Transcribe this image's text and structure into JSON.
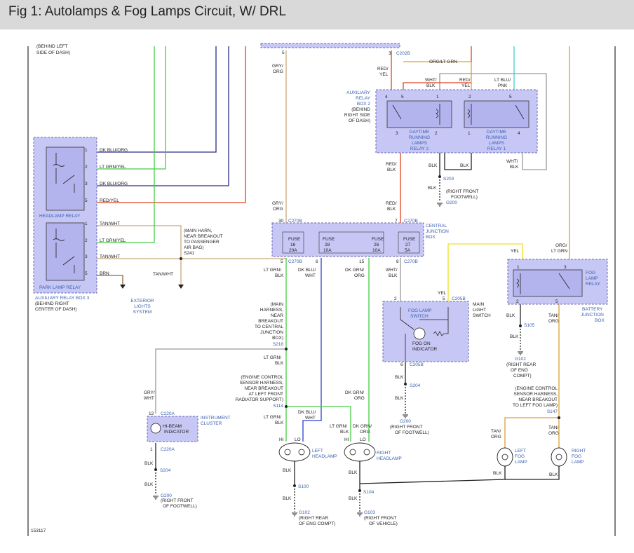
{
  "title": "Fig 1: Autolamps & Fog Lamps Circuit, W/ DRL",
  "colors": {
    "title_bg": "#d9d9d9",
    "component_fill": "#c7c7f5",
    "label_blue": "#3a5fb0",
    "wire_green": "#44cc44",
    "wire_navy": "#2a2a8a",
    "wire_blue": "#2a3fd0",
    "wire_red": "#e04020",
    "wire_tan": "#c8a878",
    "wire_gray": "#999999",
    "wire_orange": "#d9a030",
    "wire_yellow": "#f0e020",
    "wire_cyan": "#40d0d0",
    "wire_black": "#222222",
    "wire_brown": "#8a6a30"
  },
  "figure_number": "153117",
  "labels": {
    "behind_left_dash": "SIDE OF DASH)",
    "behind_left_dash_top": "(BEHIND LEFT",
    "c202b": "C202B",
    "pin5_top": "5",
    "pin3_top": "3",
    "gry_org_top1": "GRY/",
    "gry_org_top2": "ORG",
    "org_lt_grn_top": "ORG/LT GRN",
    "red_yel1": "RED/",
    "red_yel2": "YEL",
    "wht_blk1": "WHT/",
    "wht_blk2": "BLK",
    "red_yel_b1": "RED/",
    "red_yel_b2": "YEL",
    "lt_blu_pnk1": "LT BLU/",
    "lt_blu_pnk2": "PNK",
    "aux_relay_box2": [
      "AUXILIARY",
      "RELAY",
      "BOX 2",
      "(BEHIND",
      "RIGHT SIDE",
      "OF DASH)"
    ],
    "drl_relay2": [
      "DAYTIME",
      "RUNNING",
      "LAMPS",
      "RELAY 2"
    ],
    "drl_relay1": [
      "DAYTIME",
      "RUNNING",
      "LAMPS",
      "RELAY 1"
    ],
    "red_blk_a1": "RED/",
    "red_blk_a2": "BLK",
    "blk_a": "BLK",
    "blk_b": "BLK",
    "wht_blk_r1": "WHT/",
    "wht_blk_r2": "BLK",
    "s203": "S203",
    "blk_s203": "BLK",
    "right_front_footwell": [
      "(RIGHT FRONT",
      "FOOTWELL)"
    ],
    "g200_top": "G200",
    "headlamp_relay_wires": [
      "DK BLU/ORG",
      "LT GRN/YEL",
      "DK BLU/ORG",
      "RED/YEL"
    ],
    "headlamp_relay": "HEADLAMP RELAY",
    "park_relay_wires": [
      "TAN/WHT",
      "LT GRN/YEL",
      "TAN/WHT",
      "BRN"
    ],
    "park_lamp_relay": "PARK LAMP RELAY",
    "aux_relay_box3": [
      "AUXILIARY RELAY BOX 3",
      "(BEHIND RIGHT",
      "CENTER OF DASH)"
    ],
    "main_harn": [
      "(MAIN HARN,",
      "NEAR BREAKOUT",
      "TO PASSENGER",
      "AIR BAG)",
      "S241"
    ],
    "tan_wht_mid": "TAN/WHT",
    "exterior_lights": [
      "EXTERIOR",
      "LIGHTS",
      "SYSTEM"
    ],
    "gry_org_mid1": "GRY/",
    "gry_org_mid2": "ORG",
    "red_blk_b1": "RED/",
    "red_blk_b2": "BLK",
    "c270b_a": "C270B",
    "c270b_b": "C270B",
    "c270b_c": "C270B",
    "central_junction": [
      "CENTRAL",
      "JUNCTION",
      "BOX"
    ],
    "fuses": [
      {
        "pin_in": "30",
        "name": "FUSE",
        "num": "16",
        "amp": "20A",
        "pin_out": "5"
      },
      {
        "pin_in": "",
        "name": "FUSE",
        "num": "28",
        "amp": "10A",
        "pin_out": "6"
      },
      {
        "pin_in": "",
        "name": "FUSE",
        "num": "26",
        "amp": "10A",
        "pin_out": "15"
      },
      {
        "pin_in": "7",
        "name": "FUSE",
        "num": "27",
        "amp": "5A",
        "pin_out": "8"
      }
    ],
    "lt_grn_blk1": "LT GRN/",
    "lt_grn_blk2": "BLK",
    "dk_blu_wht1": "DK BLU/",
    "dk_blu_wht2": "WHT",
    "dk_grn_org1": "DK GRN/",
    "dk_grn_org2": "ORG",
    "wht_blk_f1": "WHT/",
    "wht_blk_f2": "BLK",
    "yel_a": "YEL",
    "yel_b": "YEL",
    "c205b_a": "C205B",
    "c205b_b": "C205B",
    "fog_lamp_switch": [
      "FOG LAMP",
      "SWITCH"
    ],
    "main_light_switch": [
      "MAIN",
      "LIGHT",
      "SWITCH"
    ],
    "fog_on": [
      "FOG ON",
      "INDICATOR"
    ],
    "org_lt_grn_r1": "ORG/",
    "org_lt_grn_r2": "LT GRN",
    "fog_lamp_relay": [
      "FOG",
      "LAMP",
      "RELAY"
    ],
    "battery_junction": [
      "BATTERY",
      "JUNCTION",
      "BOX"
    ],
    "blk_r": "BLK",
    "tan_org_r1": "TAN/",
    "tan_org_r2": "ORG",
    "s105": "S105",
    "blk_s105": "BLK",
    "g102_r": "G102",
    "right_rear_eng": [
      "(RIGHT REAR",
      "OF ENG",
      "COMPT)"
    ],
    "main_harness_block": [
      "(MAIN",
      "HARNESS,",
      "NEAR",
      "BREAKOUT",
      "TO CENTRAL",
      "JUNCTION",
      "BOX)",
      "S218"
    ],
    "lt_grn_blk_b1": "LT GRN/",
    "lt_grn_blk_b2": "BLK",
    "blk_fs": "BLK",
    "s204_a": "S204",
    "blk_g200": "BLK",
    "g200_mid": "G200",
    "right_front_footwell_b": [
      "(RIGHT FRONT",
      "OF FOOTWELL)"
    ],
    "gry_wht1": "GRY/",
    "gry_wht2": "WHT",
    "c220a_a": "C220A",
    "c220a_b": "C220A",
    "hibeam": [
      "HI-BEAM",
      "INDICATOR"
    ],
    "instrument_cluster": [
      "INSTRUMENT",
      "CLUSTER"
    ],
    "pin12": "12",
    "pin1": "1",
    "blk_ic": "BLK",
    "s204_b": "S204",
    "blk_ic2": "BLK",
    "g200_b": "G200",
    "right_front_footwell_c": [
      "(RIGHT FRONT",
      "OF FOOTWELL)"
    ],
    "engine_control_l": [
      "(ENGINE CONTROL",
      "SENSOR HARNESS,",
      "NEAR BREAKOUT",
      "AT LEFT FRONT",
      "RADIATOR SUPPORT)",
      "S114"
    ],
    "lt_grn_blk_c1": "LT GRN/",
    "lt_grn_blk_c2": "BLK",
    "dk_blu_wht_b1": "DK BLU/",
    "dk_blu_wht_b2": "WHT",
    "dk_grn_org_b1": "DK GRN/",
    "dk_grn_org_b2": "ORG",
    "lt_grn_blk_d1": "LT GRN/",
    "lt_grn_blk_d2": "BLK",
    "dk_grn_org_c1": "DK GRN/",
    "dk_grn_org_c2": "ORG",
    "hi_l": "HI",
    "lo_l": "LO",
    "hi_r": "HI",
    "lo_r": "LO",
    "left_headlamp": [
      "LEFT",
      "HEADLAMP"
    ],
    "right_headlamp": [
      "RIGHT",
      "HEADLAMP"
    ],
    "blk_lh": "BLK",
    "s100": "S100",
    "blk_lh2": "BLK",
    "g102_l": "G102",
    "right_rear_eng_l": [
      "(RIGHT REAR",
      "OF ENG COMPT)"
    ],
    "blk_rh": "BLK",
    "s104": "S104",
    "blk_rh2": "BLK",
    "g103": "G103",
    "right_front_vehicle": [
      "(RIGHT FRONT",
      "OF VEHICLE)"
    ],
    "engine_control_r": [
      "(ENGINE CONTROL",
      "SENSOR HARNESS,",
      "NEAR BREAKOUT",
      "TO LEFT FOG LAMP)",
      "S147"
    ],
    "tan_org_fl1": "TAN/",
    "tan_org_fl2": "ORG",
    "tan_org_fr1": "TAN/",
    "tan_org_fr2": "ORG",
    "left_fog_lamp": [
      "LEFT",
      "FOG",
      "LAMP"
    ],
    "right_fog_lamp": [
      "RIGHT",
      "FOG",
      "LAMP"
    ],
    "blk_fl": "BLK",
    "blk_fr": "BLK"
  }
}
